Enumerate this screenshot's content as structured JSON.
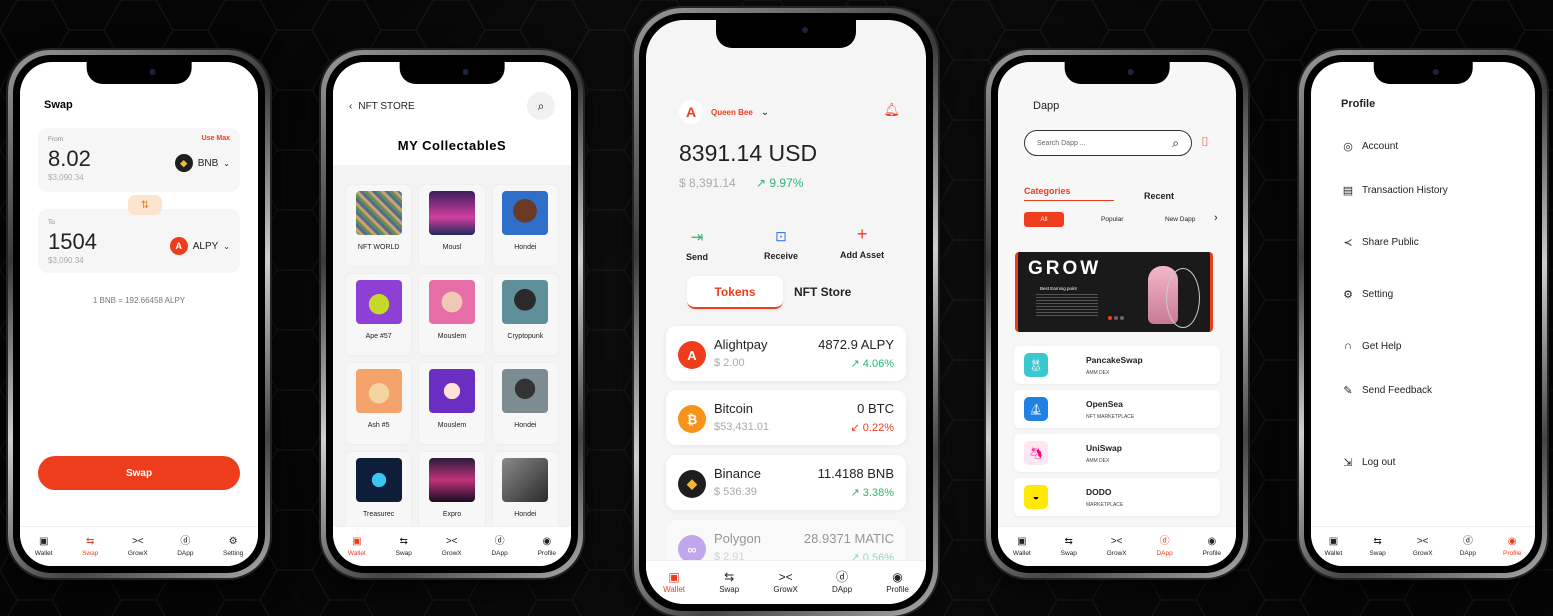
{
  "tabs": {
    "wallet": "Wallet",
    "swap": "Swap",
    "growx": "GrowX",
    "dapp": "DApp",
    "setting": "Setting",
    "profile": "Profile"
  },
  "swap_screen": {
    "title": "Swap",
    "from_label": "From",
    "use_max": "Use Max",
    "from_amount": "8.02",
    "from_fiat": "$3,090.34",
    "from_token": "BNB",
    "to_label": "To",
    "to_amount": "1504",
    "to_fiat": "$3,090.34",
    "to_token": "ALPY",
    "rate": "1 BNB = 192.66458 ALPY",
    "swap_button": "Swap"
  },
  "nft_screen": {
    "back_title": "NFT STORE",
    "heading": "MY CollectableS",
    "items": [
      {
        "name": "NFT WORLD"
      },
      {
        "name": "Mousl"
      },
      {
        "name": "Hondei"
      },
      {
        "name": "Ape #57"
      },
      {
        "name": "Mouslem"
      },
      {
        "name": "Cryptopunk"
      },
      {
        "name": "Ash #5"
      },
      {
        "name": "Mouslem"
      },
      {
        "name": "Hondei"
      },
      {
        "name": "Treasurec"
      },
      {
        "name": "Expro"
      },
      {
        "name": "Hondei"
      }
    ]
  },
  "wallet_screen": {
    "account_name": "Queen Bee",
    "balance": "8391.14 USD",
    "balance_fiat": "$ 8,391.14",
    "balance_change": "↗ 9.97%",
    "actions": {
      "send": "Send",
      "receive": "Receive",
      "add_asset": "Add Asset"
    },
    "segment": {
      "tokens": "Tokens",
      "nft_store": "NFT Store"
    },
    "tokens": [
      {
        "name": "Alightpay",
        "price": "$ 2.00",
        "amount": "4872.9 ALPY",
        "change": "↗  4.06%",
        "direction": "up",
        "color": "#ee3d1d",
        "symbol": "A"
      },
      {
        "name": "Bitcoin",
        "price": "$53,431.01",
        "amount": "0 BTC",
        "change": "↙  0.22%",
        "direction": "down",
        "color": "#f7931a",
        "symbol": "₿"
      },
      {
        "name": "Binance",
        "price": "$ 536.39",
        "amount": "11.4188 BNB",
        "change": "↗  3.38%",
        "direction": "up",
        "color": "#1e1e1e",
        "symbol": "◆"
      },
      {
        "name": "Polygon",
        "price": "$ 2.91",
        "amount": "28.9371 MATIC",
        "change": "↗  0.56%",
        "direction": "up",
        "color": "#8247e5",
        "symbol": "∞"
      }
    ]
  },
  "dapp_screen": {
    "title": "Dapp",
    "search_placeholder": "Search Dapp ...",
    "categories_tab": "Categories",
    "recent_tab": "Recent",
    "chips": {
      "all": "All",
      "popular": "Popular",
      "new_dapp": "New Dapp"
    },
    "banner_word": "GROW",
    "banner_sub": "Best Earning point",
    "items": [
      {
        "name": "PancakeSwap",
        "desc": "AMM DEX",
        "color": "#3ac7d0"
      },
      {
        "name": "OpenSea",
        "desc": "NFT MARKETPLACE",
        "color": "#2081e2"
      },
      {
        "name": "UniSwap",
        "desc": "AMM DEX",
        "color": "#ffe6f2"
      },
      {
        "name": "DODO",
        "desc": "MARKETPLACE",
        "color": "#ffe804"
      }
    ]
  },
  "profile_screen": {
    "title": "Profile",
    "items": {
      "account": "Account",
      "transactions": "Transaction History",
      "share": "Share Public",
      "setting": "Setting",
      "help": "Get Help",
      "feedback": "Send Feedback",
      "logout": "Log out"
    }
  }
}
